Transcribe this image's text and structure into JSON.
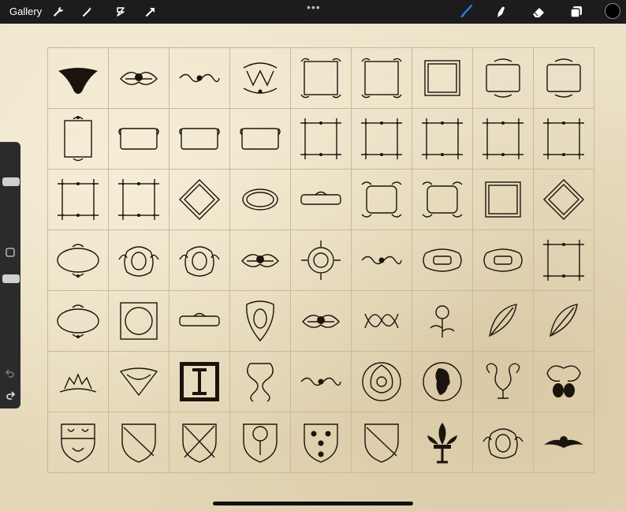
{
  "topbar": {
    "gallery_label": "Gallery",
    "more_label": "•••",
    "left_tools": [
      {
        "name": "wrench-icon"
      },
      {
        "name": "magic-wand-icon"
      },
      {
        "name": "selection-icon"
      },
      {
        "name": "transform-arrow-icon"
      }
    ],
    "right_tools": [
      {
        "name": "brush-icon"
      },
      {
        "name": "smudge-icon"
      },
      {
        "name": "eraser-icon"
      },
      {
        "name": "layers-icon"
      }
    ],
    "current_color": "#000000",
    "brush_accent": "#2f7cf6"
  },
  "sidebar": {
    "brush_size_level": 0.85,
    "opacity_level": 0.35,
    "modify_button": "square-icon",
    "undo": "undo-icon",
    "redo": "redo-icon"
  },
  "canvas": {
    "rows": 7,
    "cols": 9,
    "items": [
      "corner-ornament",
      "floral-ornament",
      "scroll-divider",
      "monogram-ornament",
      "swirl-frame",
      "swirl-frame",
      "square-frame",
      "flourish-frame",
      "flourish-frame",
      "tall-frame",
      "rect-frame",
      "rect-frame",
      "rect-frame",
      "corner-frame",
      "corner-frame",
      "corner-frame",
      "corner-frame",
      "corner-frame",
      "corner-frame",
      "corner-frame",
      "diamond-frame",
      "oval-cartouche",
      "banner-plate",
      "ornate-frame",
      "ornate-frame",
      "square-frame",
      "diamond-frame",
      "oval-frame",
      "crest-cartouche",
      "crest-cartouche",
      "floral-ornament",
      "round-cartouche",
      "scroll-divider",
      "scroll-cartouche",
      "scroll-cartouche",
      "corner-frame",
      "oval-frame",
      "circle-frame",
      "banner-plate",
      "shield-cartouche",
      "floral-ornament",
      "knot-ornament",
      "flower-ornament",
      "feather-ornament",
      "feather-ornament",
      "crown-ornament",
      "lace-ornament",
      "initial-letter",
      "serpent-ornament",
      "scroll-divider",
      "celtic-circle",
      "cameo-medallion",
      "swirl-ornament",
      "leaf-ornament",
      "shield-birds",
      "shield-bend",
      "shield-saltire",
      "shield-tree",
      "shield-flowers",
      "shield-bend",
      "fleur-de-lis",
      "crest-cartouche",
      "bird-ornament"
    ]
  }
}
